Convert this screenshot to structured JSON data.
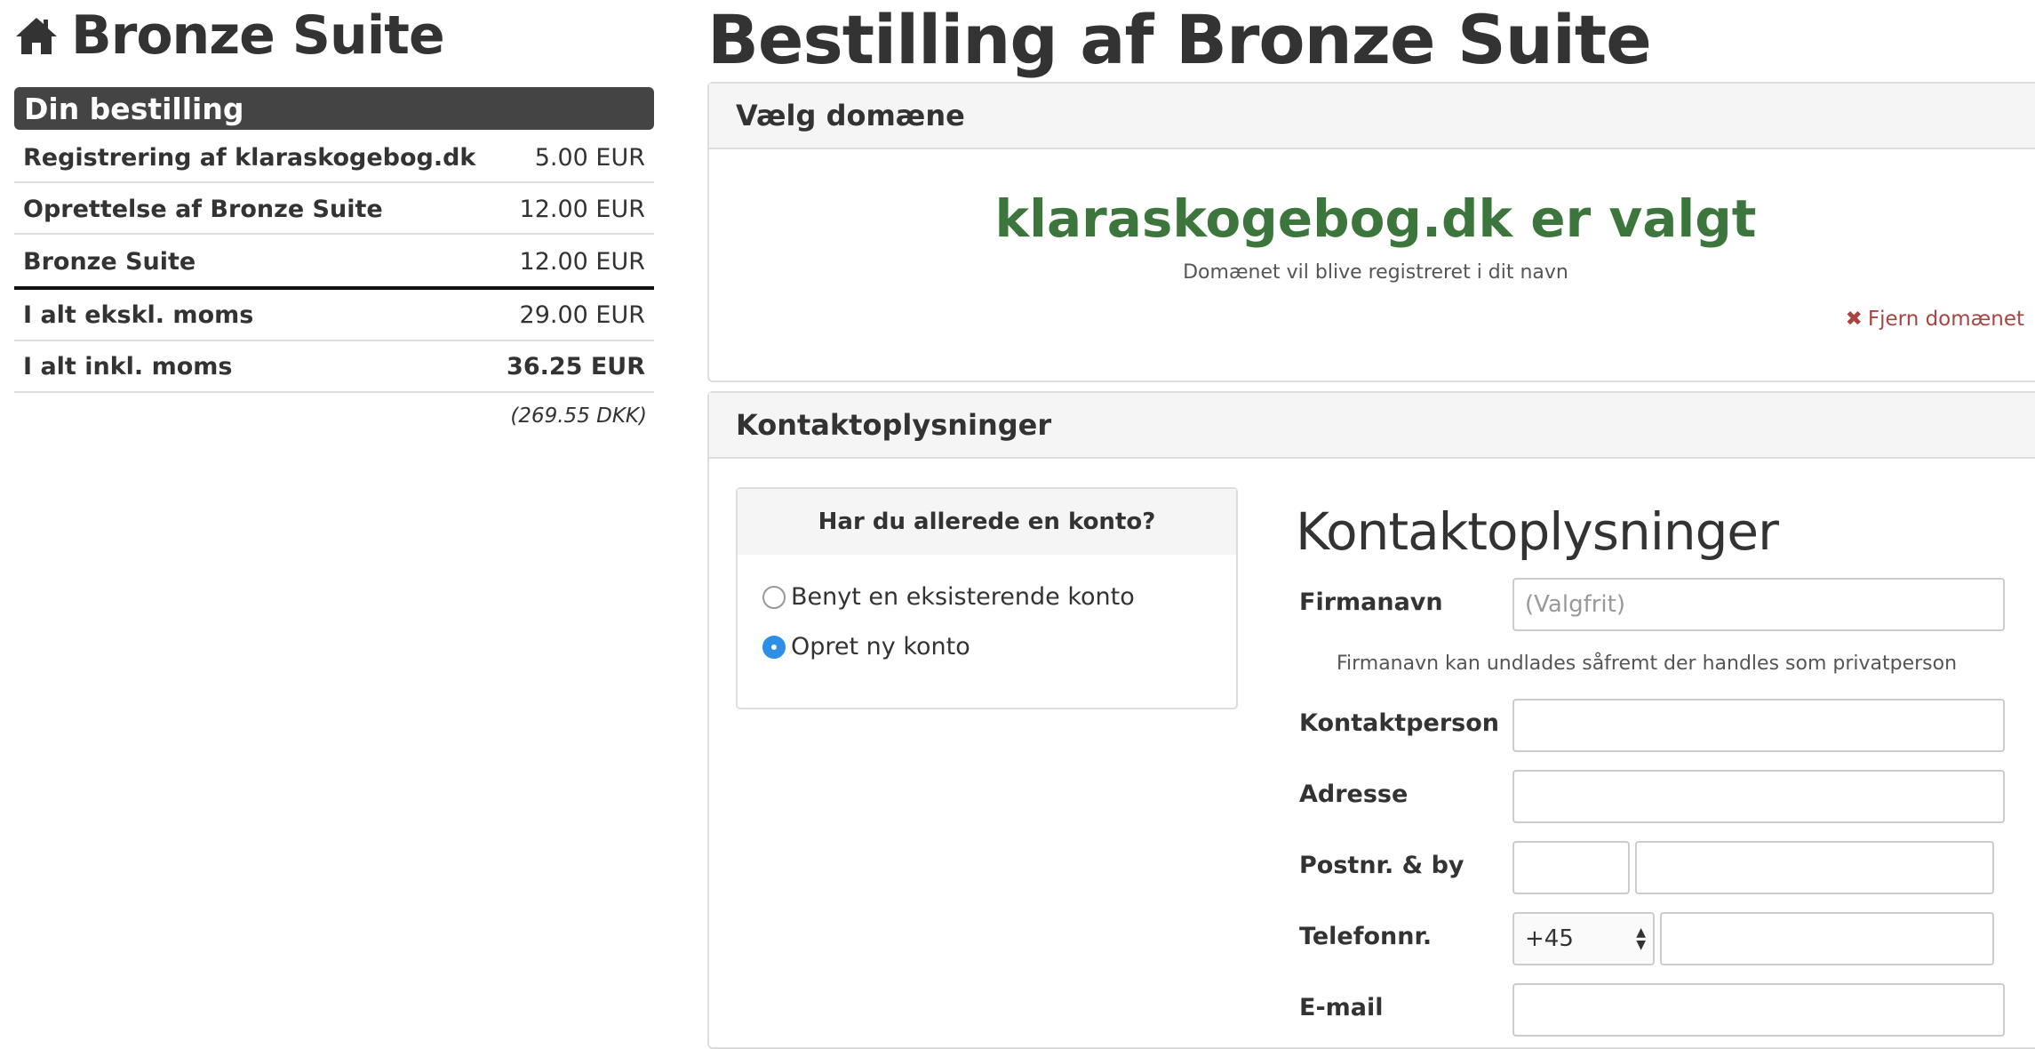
{
  "product": {
    "title": "Bronze Suite",
    "home_icon": "home-icon"
  },
  "order": {
    "header": "Din bestilling",
    "rows": [
      {
        "label": "Registrering af klaraskogebog.dk",
        "amount": "5.00 EUR"
      },
      {
        "label": "Oprettelse af Bronze Suite",
        "amount": "12.00 EUR"
      },
      {
        "label": "Bronze Suite",
        "amount": "12.00 EUR"
      }
    ],
    "total_excl": {
      "label": "I alt ekskl. moms",
      "amount": "29.00 EUR"
    },
    "total_incl": {
      "label": "I alt inkl. moms",
      "amount": "36.25 EUR"
    },
    "dkk": "(269.55 DKK)"
  },
  "page": {
    "heading": "Bestilling af Bronze Suite"
  },
  "domain_panel": {
    "title": "Vælg domæne",
    "chosen": "klaraskogebog.dk er valgt",
    "note": "Domænet vil blive registreret i dit navn",
    "remove_icon": "✖",
    "remove_label": "Fjern domænet"
  },
  "contact_panel": {
    "title": "Kontaktoplysninger",
    "account_question": "Har du allerede en konto?",
    "options": [
      {
        "label": "Benyt en eksisterende konto",
        "selected": false
      },
      {
        "label": "Opret ny konto",
        "selected": true
      }
    ],
    "form": {
      "heading": "Kontaktoplysninger",
      "firm_label": "Firmanavn",
      "firm_placeholder": "(Valgfrit)",
      "firm_help": "Firmanavn kan undlades såfremt der handles som privatperson",
      "contact_label": "Kontaktperson",
      "address_label": "Adresse",
      "postal_label": "Postnr. & by",
      "phone_label": "Telefonnr.",
      "phone_prefix": "+45",
      "email_label": "E-mail"
    }
  },
  "colors": {
    "success": "#3c763d",
    "danger": "#a94442",
    "radio_selected": "#2f8ee6",
    "header_dark": "#444444"
  }
}
